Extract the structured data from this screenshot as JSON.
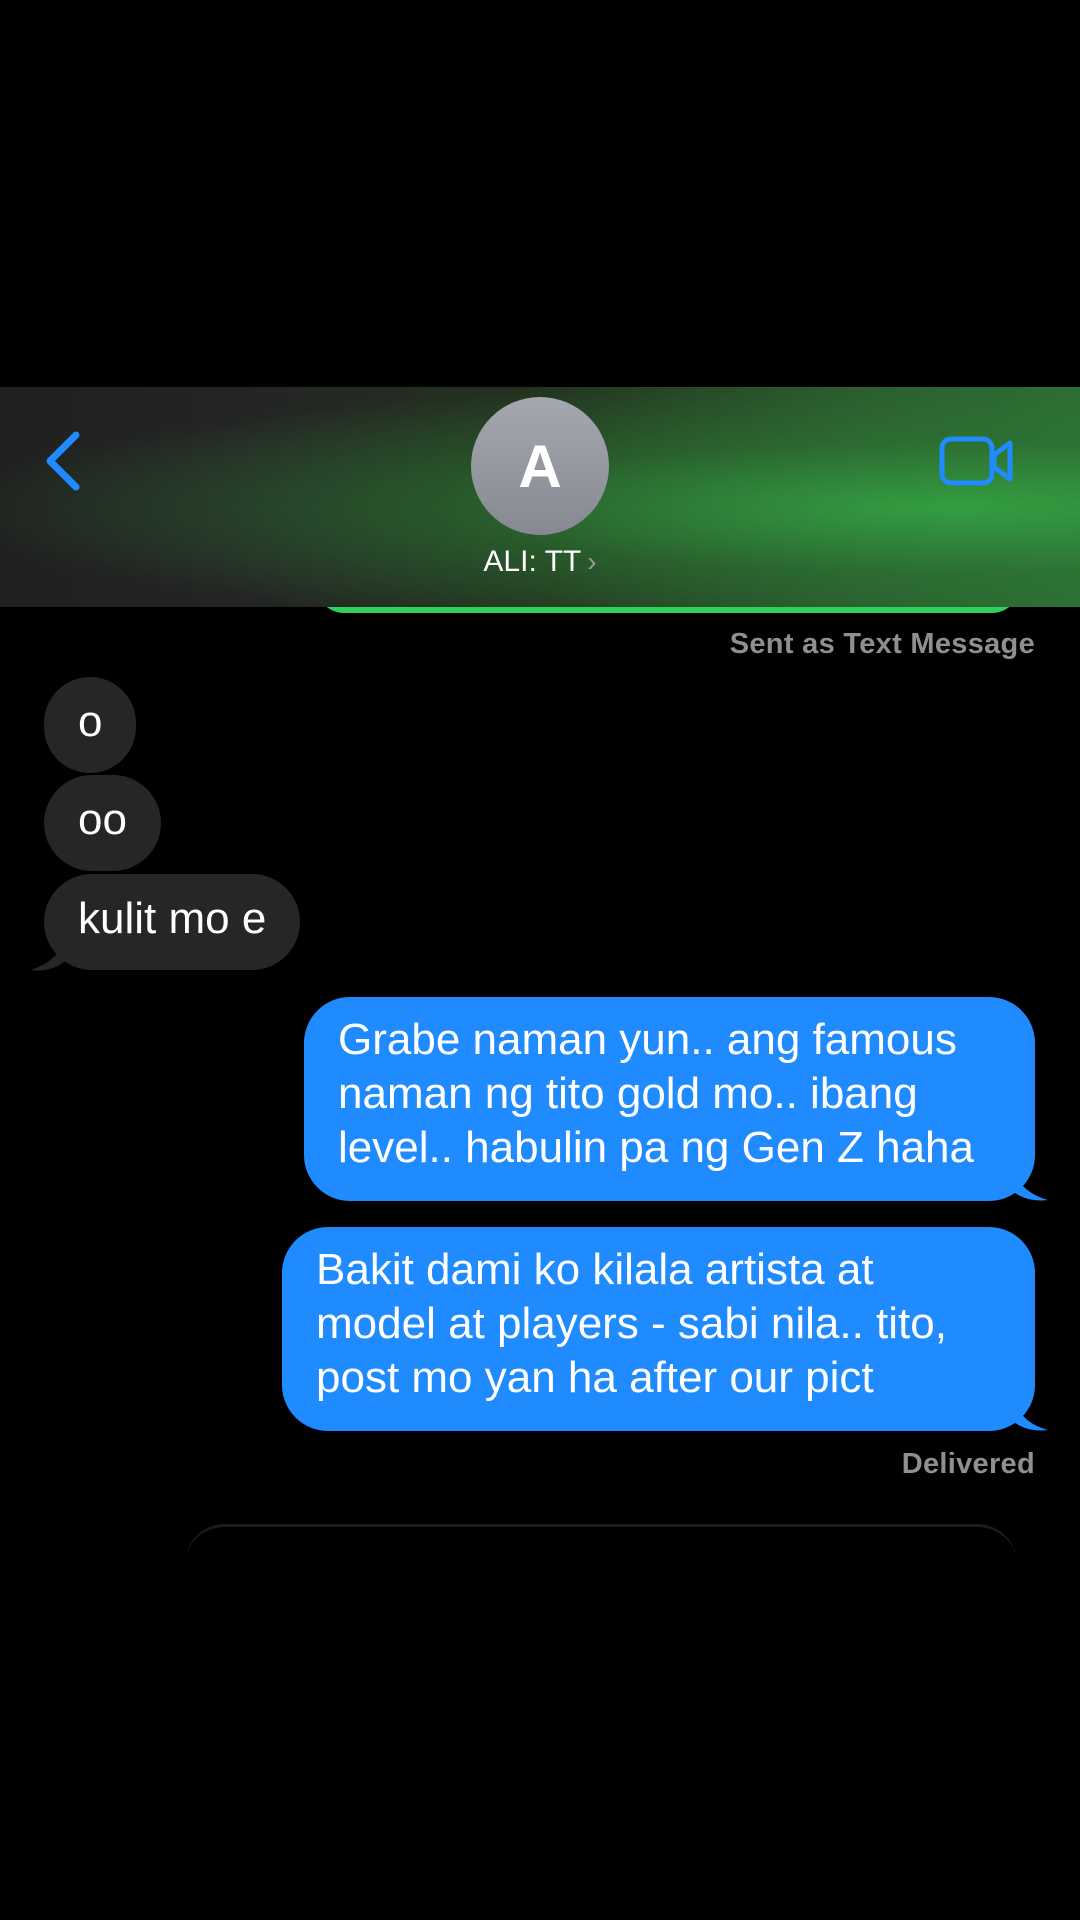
{
  "header": {
    "avatar_initial": "A",
    "contact_name": "ALI: TT",
    "chevron": "›",
    "back_icon": "chevron-left-icon",
    "video_icon": "video-camera-icon"
  },
  "thread": {
    "sent_status": "Sent as Text Message",
    "incoming": [
      {
        "text": "o"
      },
      {
        "text": "oo"
      },
      {
        "text": "kulit mo e"
      }
    ],
    "outgoing": [
      {
        "text": "Grabe naman yun.. ang famous naman ng tito gold mo.. ibang level.. habulin pa ng Gen Z haha"
      },
      {
        "text": "Bakit dami ko kilala artista at model at players - sabi nila.. tito, post mo yan ha after our pict"
      }
    ],
    "delivered_status": "Delivered"
  },
  "colors": {
    "outgoing_bubble": "#1f8bff",
    "incoming_bubble": "#262629",
    "sms_bubble": "#30d158",
    "accent": "#1f8bff"
  }
}
